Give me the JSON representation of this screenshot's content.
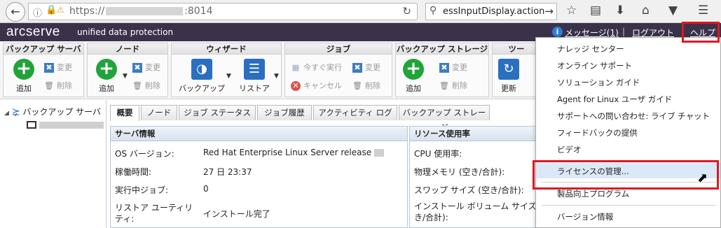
{
  "browser": {
    "url_prefix": "https://",
    "url_suffix": ":8014",
    "search_text": "essInputDisplay.action"
  },
  "header": {
    "logo": "arcserve",
    "product": "unified data protection",
    "messages_label": "メッセージ(1)",
    "separator": "|",
    "logout_label": "ログアウト",
    "help_label": "ヘルプ"
  },
  "ribbon": {
    "groups": [
      {
        "title": "バックアップ サーバ",
        "add": "追加",
        "edit": "変更",
        "delete": "削除"
      },
      {
        "title": "ノード",
        "add": "追加",
        "edit": "変更",
        "delete": "削除"
      },
      {
        "title": "ウィザード",
        "backup": "バックアップ",
        "restore": "リストア"
      },
      {
        "title": "ジョブ",
        "run_now": "今すぐ実行",
        "cancel": "キャンセル",
        "edit": "変更",
        "delete": "削除"
      },
      {
        "title": "バックアップ ストレージ",
        "add": "追加",
        "edit": "変更",
        "delete": "削除"
      },
      {
        "title": "ツー",
        "refresh": "更新"
      }
    ]
  },
  "tree": {
    "root_label": "バックアップ サーバ"
  },
  "tabs": [
    "概要",
    "ノード",
    "ジョブ ステータス",
    "ジョブ履歴",
    "アクティビティ ログ",
    "バックアップ ストレージ"
  ],
  "server_info": {
    "title": "サーバ情報",
    "rows": [
      {
        "label": "OS バージョン:",
        "value": "Red Hat Enterprise Linux Server release"
      },
      {
        "label": "稼働時間:",
        "value": "27 日 23:37"
      },
      {
        "label": "実行中ジョブ:",
        "value": "0"
      },
      {
        "label": "リストア ユーティリティ:",
        "value": "インストール完了"
      }
    ]
  },
  "resources": {
    "title": "リソース使用率",
    "rows": [
      {
        "label": "CPU 使用率:"
      },
      {
        "label": "物理メモリ (空き/合計):"
      },
      {
        "label": "スワップ サイズ (空き/合計):"
      },
      {
        "label": "インストール ボリューム サイズ (空き/合計):"
      }
    ]
  },
  "help_menu": {
    "items": [
      "ナレッジ センター",
      "オンライン サポート",
      "ソリューション ガイド",
      "Agent for Linux ユーザ ガイド",
      "サポートへの問い合わせ: ライブ チャット",
      "フィードバックの提供",
      "ビデオ",
      "ライセンスの管理...",
      "製品向上プログラム",
      "バージョン情報"
    ]
  },
  "colors": {
    "header_bg": "#3a324b",
    "highlight_red": "#e01820",
    "menu_hover": "#dbe8f7",
    "add_green": "#22a33a",
    "accent_blue": "#2a6fc0"
  }
}
